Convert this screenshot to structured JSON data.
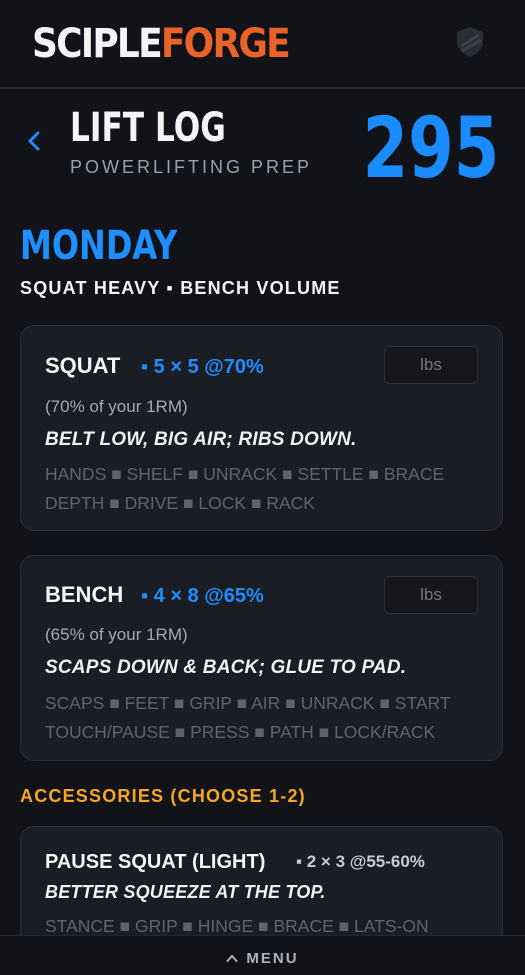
{
  "brand": {
    "part1": "SCIPLE",
    "part2": "FORGE",
    "accent": "#e8622a"
  },
  "header": {
    "shield_icon": "shield-icon",
    "back_icon": "chevron-left-icon",
    "title": "LIFT LOG",
    "subtitle": "POWERLIFTING PREP",
    "score": "295",
    "accent": "#1f8fff"
  },
  "day": {
    "name": "MONDAY",
    "focus": "SQUAT HEAVY ▪ BENCH VOLUME"
  },
  "lifts": [
    {
      "name": "SQUAT",
      "sets": "▪ 5 × 5 @70%",
      "input_placeholder": "lbs",
      "percent_note": "(70% of your 1RM)",
      "cue": "BELT LOW, BIG AIR; RIBS DOWN.",
      "steps_line1": "HANDS ■ SHELF ■ UNRACK ■ SETTLE ■ BRACE",
      "steps_line2": "DEPTH ■ DRIVE ■ LOCK ■ RACK"
    },
    {
      "name": "BENCH",
      "sets": "▪ 4 × 8 @65%",
      "input_placeholder": "lbs",
      "percent_note": "(65% of your 1RM)",
      "cue": "SCAPS DOWN & BACK; GLUE TO PAD.",
      "steps_line1": "SCAPS ■ FEET ■ GRIP ■ AIR ■ UNRACK ■ START",
      "steps_line2": "TOUCH/PAUSE ■ PRESS ■ PATH ■ LOCK/RACK"
    }
  ],
  "accessories": {
    "heading": "ACCESSORIES (CHOOSE 1-2)",
    "color": "#f6a623",
    "items": [
      {
        "name": "PAUSE SQUAT (LIGHT)",
        "sets": "▪ 2 × 3 @55-60%",
        "cue": "BETTER SQUEEZE AT THE TOP.",
        "steps_line1": "STANCE ■ GRIP ■ HINGE ■ BRACE ■ LATS-ON"
      }
    ]
  },
  "footer": {
    "menu_label": "MENU",
    "menu_icon": "chevron-up-icon"
  }
}
